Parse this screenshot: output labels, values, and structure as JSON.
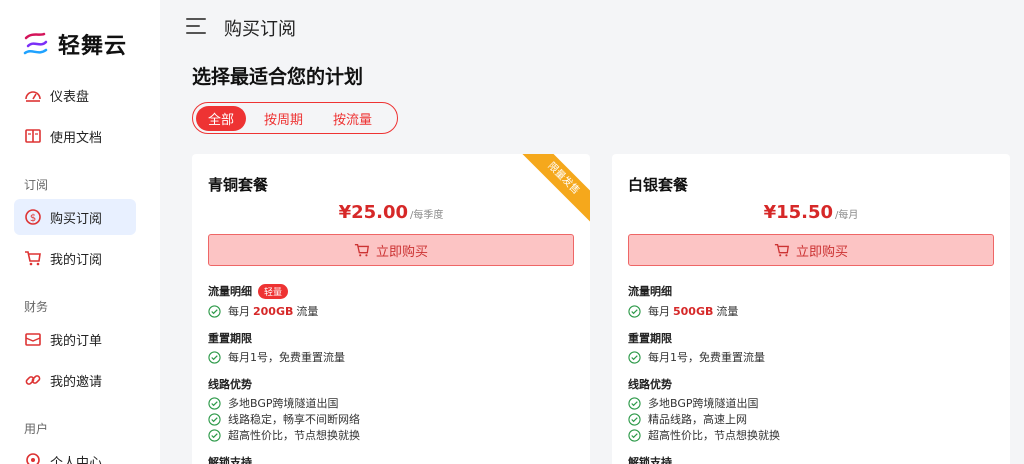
{
  "brand": {
    "name": "轻舞云",
    "logo_icon": "ribbon-logo-icon"
  },
  "sidebar": {
    "items": [
      {
        "label": "仪表盘",
        "icon": "dashboard-icon"
      },
      {
        "label": "使用文档",
        "icon": "book-icon"
      },
      {
        "label": "购买订阅",
        "icon": "dollar-icon",
        "active": true
      },
      {
        "label": "我的订阅",
        "icon": "cart-icon"
      },
      {
        "label": "我的订单",
        "icon": "receipt-icon"
      },
      {
        "label": "我的邀请",
        "icon": "link-icon"
      },
      {
        "label": "个人中心",
        "icon": "user-pin-icon"
      }
    ],
    "sections": [
      "订阅",
      "财务",
      "用户"
    ]
  },
  "header": {
    "title": "购买订阅",
    "menu_icon": "hamburger-icon"
  },
  "main": {
    "heading": "选择最适合您的计划",
    "tabs": [
      "全部",
      "按周期",
      "按流量"
    ],
    "active_tab": "全部"
  },
  "plans": [
    {
      "name": "青铜套餐",
      "price": "¥25.00",
      "period": "/每季度",
      "ribbon": "限量发售",
      "buy_label": "立即购买",
      "traffic_title": "流量明细",
      "traffic_badge": "轻量",
      "traffic_prefix": "每月",
      "traffic_value": "200GB",
      "traffic_suffix": "流量",
      "reset_title": "重置期限",
      "reset_text": "每月1号，免费重置流量",
      "route_title": "线路优势",
      "route_features": [
        "多地BGP跨境隧道出国",
        "线路稳定，畅享不间断网络",
        "超高性价比，节点想换就换"
      ],
      "unlock_title": "解锁支持"
    },
    {
      "name": "白银套餐",
      "price": "¥15.50",
      "period": "/每月",
      "buy_label": "立即购买",
      "traffic_title": "流量明细",
      "traffic_prefix": "每月",
      "traffic_value": "500GB",
      "traffic_suffix": "流量",
      "reset_title": "重置期限",
      "reset_text": "每月1号，免费重置流量",
      "route_title": "线路优势",
      "route_features": [
        "多地BGP跨境隧道出国",
        "精品线路，高速上网",
        "超高性价比，节点想换就换"
      ],
      "unlock_title": "解锁支持"
    }
  ],
  "colors": {
    "accent": "#e33333",
    "price": "#d62828",
    "ribbon": "#f5a81c",
    "active_nav": "#e8f0ff",
    "check": "#2e9a4a"
  }
}
